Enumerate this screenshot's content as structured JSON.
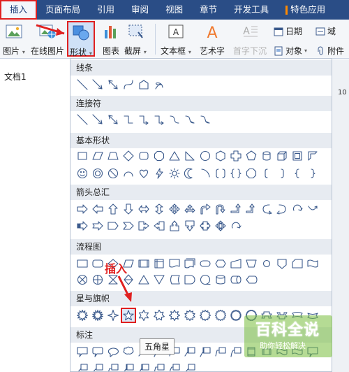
{
  "tabs": [
    "插入",
    "页面布局",
    "引用",
    "审阅",
    "视图",
    "章节",
    "开发工具",
    "特色应用"
  ],
  "ribbon": {
    "picture": "图片",
    "online_picture": "在线图片",
    "shapes": "形状",
    "chart": "图表",
    "screenshot": "截屏",
    "textbox": "文本框",
    "wordart": "艺术字",
    "dropcap": "首字下沉",
    "date": "日期",
    "object": "对象",
    "field": "域",
    "attachment": "附件"
  },
  "document": {
    "name": "文档1",
    "ruler_num": "10"
  },
  "shapes_panel": {
    "sections": [
      "线条",
      "连接符",
      "基本形状",
      "箭头总汇",
      "流程图",
      "星与旗帜",
      "标注"
    ],
    "selected_shape": "star-5",
    "tooltip": "五角星"
  },
  "annotation": "插入",
  "watermark": {
    "title": "百科全说",
    "subtitle": "助你轻松解决"
  },
  "colors": {
    "tab_bar": "#2a4d86",
    "highlight": "#e02020",
    "section_header": "#e7ebf1",
    "shape_stroke": "#3b5a8c"
  }
}
